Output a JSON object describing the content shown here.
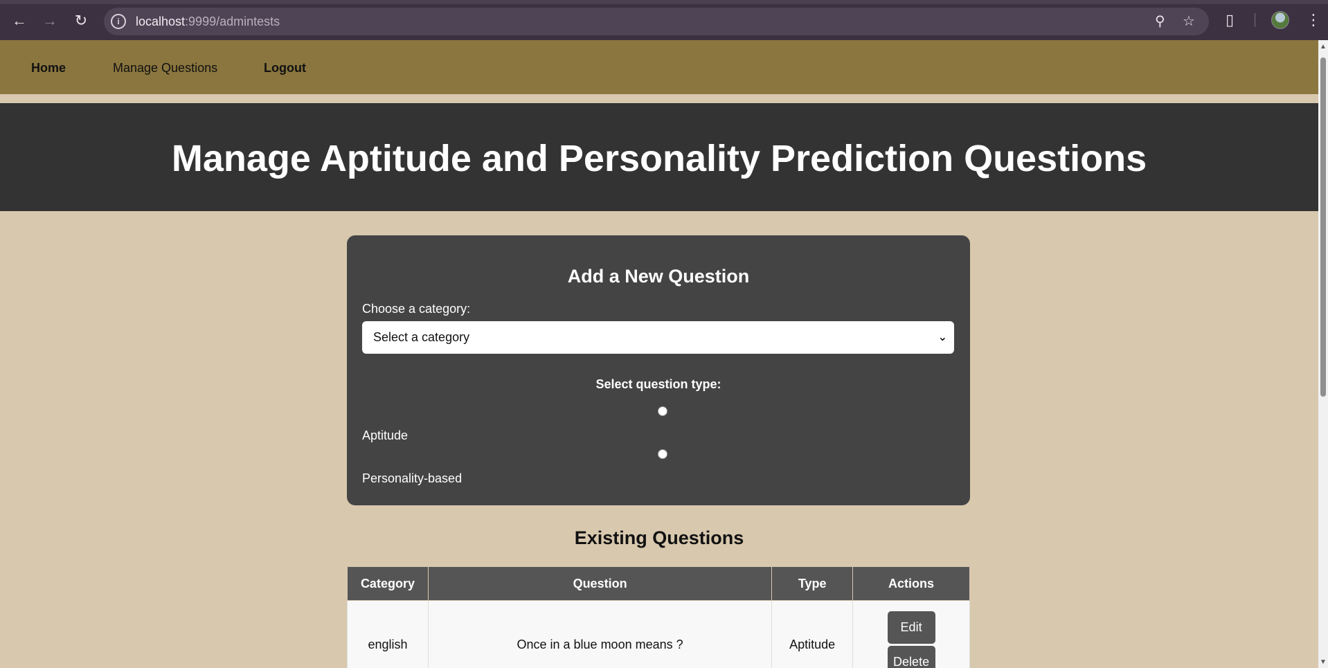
{
  "browser": {
    "url_host": "localhost",
    "url_path": ":9999/admintests"
  },
  "navbar": {
    "home": "Home",
    "manage": "Manage Questions",
    "logout": "Logout"
  },
  "header": {
    "title": "Manage Aptitude and Personality Prediction Questions"
  },
  "form": {
    "heading": "Add a New Question",
    "category_label": "Choose a category:",
    "category_selected": "Select a category",
    "question_type_label": "Select question type:",
    "options": [
      "Aptitude",
      "Personality-based"
    ]
  },
  "existing": {
    "heading": "Existing Questions",
    "columns": [
      "Category",
      "Question",
      "Type",
      "Actions"
    ],
    "rows": [
      {
        "category": "english",
        "question": "Once in a blue moon means ?",
        "type": "Aptitude",
        "edit": "Edit",
        "delete": "Delete"
      }
    ]
  }
}
